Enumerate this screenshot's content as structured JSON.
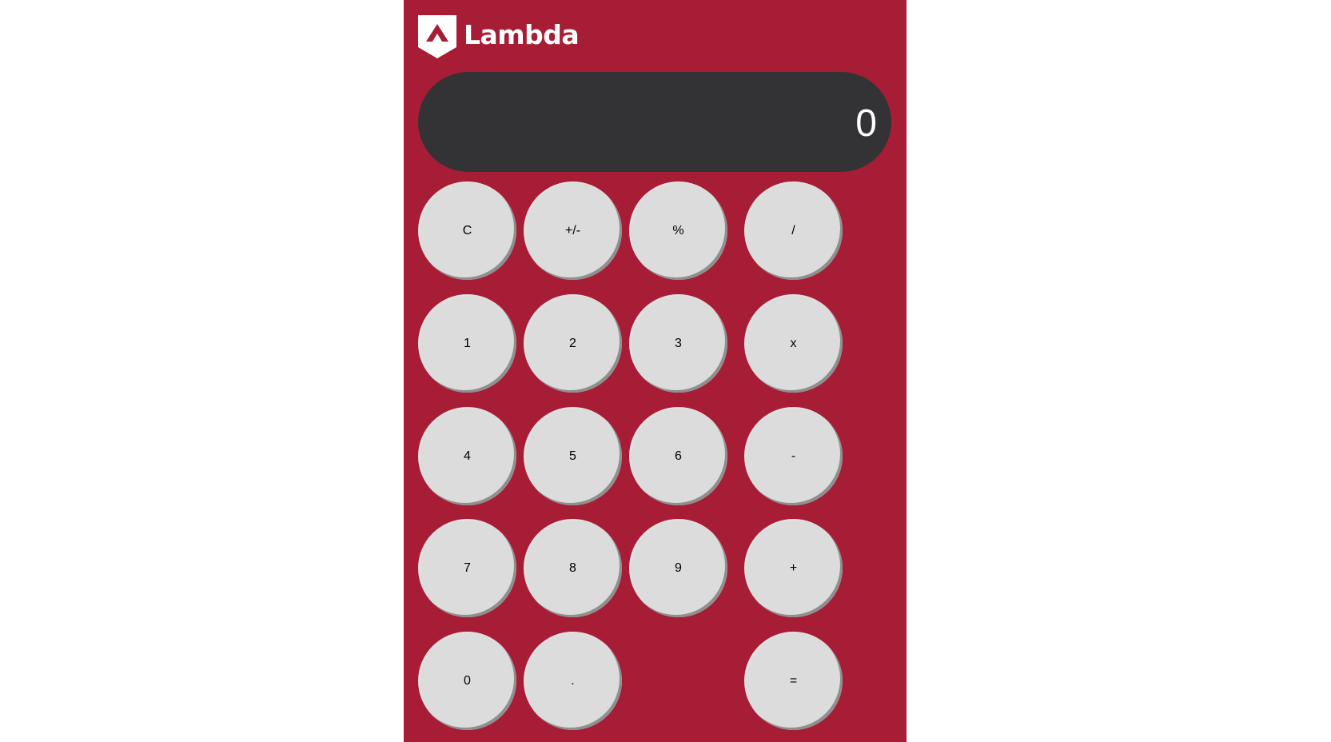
{
  "brand": {
    "name": "Lambda",
    "logo_icon": "lambda-shield-icon",
    "color": "#a71d36"
  },
  "display": {
    "value": "0",
    "background": "#333335"
  },
  "keys": {
    "clear": "C",
    "negate": "+/-",
    "percent": "%",
    "divide": "/",
    "one": "1",
    "two": "2",
    "three": "3",
    "multiply": "x",
    "four": "4",
    "five": "5",
    "six": "6",
    "subtract": "-",
    "seven": "7",
    "eight": "8",
    "nine": "9",
    "add": "+",
    "zero": "0",
    "decimal": ".",
    "equals": "="
  }
}
